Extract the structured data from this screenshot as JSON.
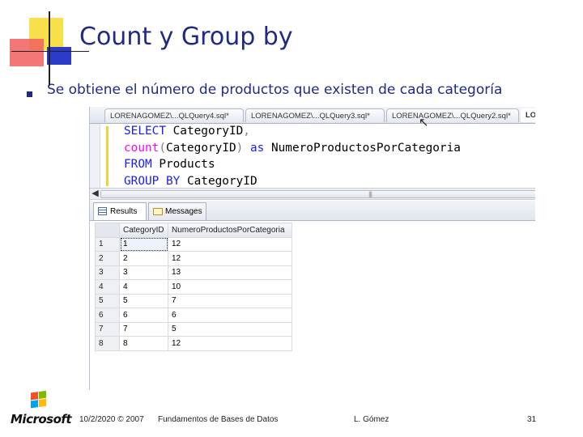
{
  "slide": {
    "title": "Count y Group by",
    "bullet": "Se obtiene el número de productos que existen de cada categoría"
  },
  "ssms": {
    "tabs": [
      {
        "label": "LORENAGOMEZ\\...QLQuery4.sql*"
      },
      {
        "label": "LORENAGOMEZ\\...QLQuery3.sql*"
      },
      {
        "label": "LORENAGOMEZ\\...QLQuery2.sql*"
      },
      {
        "label": "LO"
      }
    ],
    "query": {
      "l1_kw": "SELECT",
      "l1_rest": " Category",
      "l1_id": "ID",
      "l1_comma": ",",
      "l2_fn": "count",
      "l2_paren_open": "(",
      "l2_arg": "Category",
      "l2_arg_id": "ID",
      "l2_paren_close": ")",
      "l2_as": " as ",
      "l2_alias": "NumeroProductosPorCategoria",
      "l3_kw": "FROM",
      "l3_rest": " Products",
      "l4_kw": "GROUP BY",
      "l4_rest": " CategoryID"
    },
    "results_tabs": {
      "results": "Results",
      "messages": "Messages"
    },
    "columns": [
      "CategoryID",
      "NumeroProductosPorCategoria"
    ],
    "rows": [
      {
        "num": "1",
        "category": "1",
        "count": "12"
      },
      {
        "num": "2",
        "category": "2",
        "count": "12"
      },
      {
        "num": "3",
        "category": "3",
        "count": "13"
      },
      {
        "num": "4",
        "category": "4",
        "count": "10"
      },
      {
        "num": "5",
        "category": "5",
        "count": "7"
      },
      {
        "num": "6",
        "category": "6",
        "count": "6"
      },
      {
        "num": "7",
        "category": "7",
        "count": "5"
      },
      {
        "num": "8",
        "category": "8",
        "count": "12"
      }
    ]
  },
  "footer": {
    "logo": "Microsoft",
    "date": "10/2/2020 © 2007",
    "course": "Fundamentos de Bases de Datos",
    "author": "L. Gómez",
    "page": "31"
  },
  "colors": {
    "title": "#1f2a86",
    "sql_keyword": "#1a1aff",
    "sql_function": "#ff00ff",
    "sql_punctuation": "#808080"
  },
  "icons": [
    "grid-icon",
    "messages-icon",
    "mouse-cursor-icon",
    "windows-flag-icon",
    "scroll-left-arrow-icon"
  ]
}
